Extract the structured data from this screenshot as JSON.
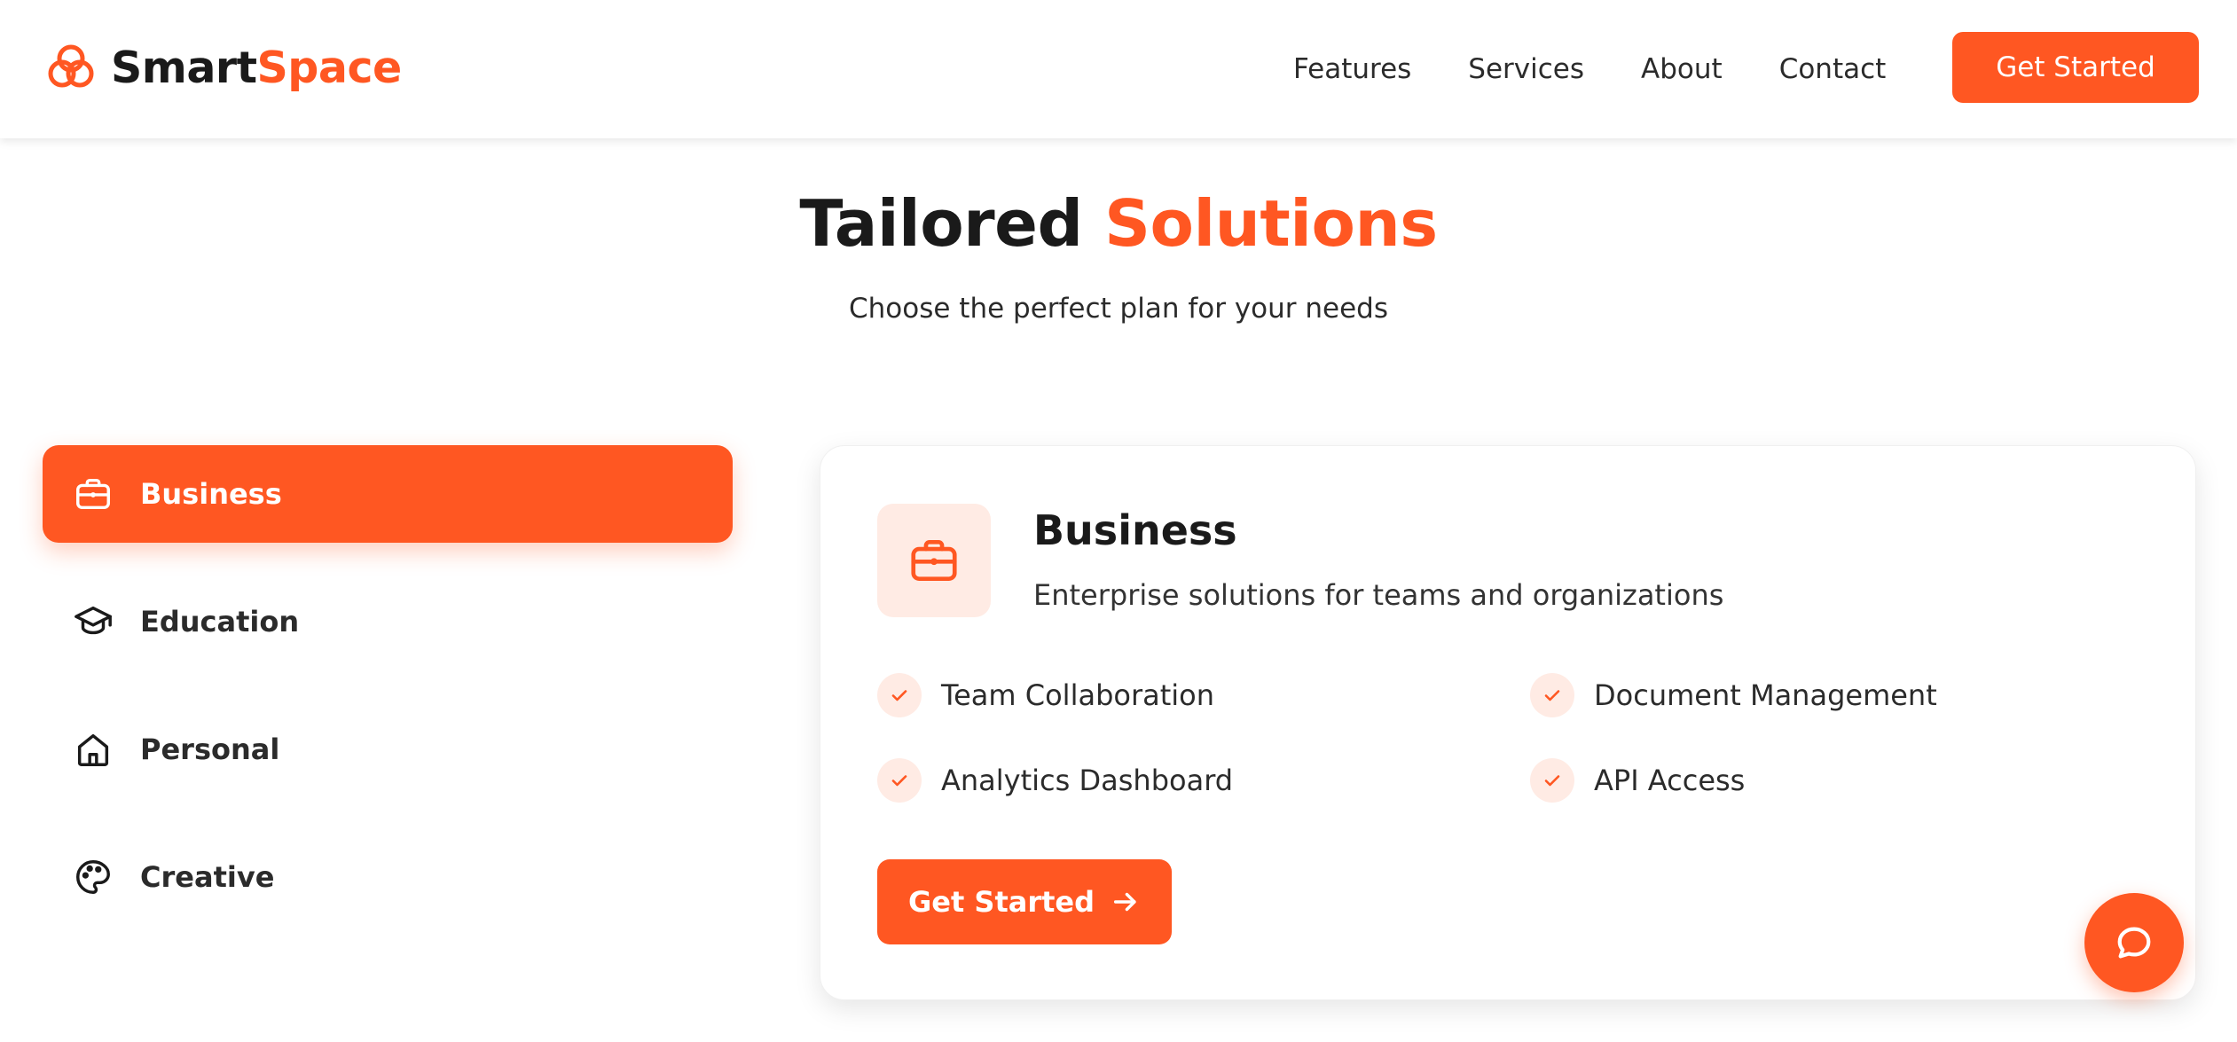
{
  "brand": {
    "name_part1": "Smart",
    "name_part2": "Space"
  },
  "nav": {
    "links": [
      "Features",
      "Services",
      "About",
      "Contact"
    ],
    "cta_label": "Get Started"
  },
  "hero": {
    "title_part1": "Tailored",
    "title_part2": "Solutions",
    "subtitle": "Choose the perfect plan for your needs"
  },
  "tabs": [
    {
      "label": "Business",
      "icon": "briefcase-icon",
      "active": true
    },
    {
      "label": "Education",
      "icon": "graduation-cap-icon",
      "active": false
    },
    {
      "label": "Personal",
      "icon": "home-icon",
      "active": false
    },
    {
      "label": "Creative",
      "icon": "palette-icon",
      "active": false
    }
  ],
  "detail": {
    "icon": "briefcase-icon",
    "title": "Business",
    "description": "Enterprise solutions for teams and organizations",
    "features": [
      "Team Collaboration",
      "Document Management",
      "Analytics Dashboard",
      "API Access"
    ],
    "cta_label": "Get Started"
  },
  "chat": {
    "icon": "chat-bubble-icon"
  },
  "colors": {
    "accent": "#ff5722",
    "accent_tint": "#ffebe4",
    "text_dark": "#1a1a1a"
  }
}
